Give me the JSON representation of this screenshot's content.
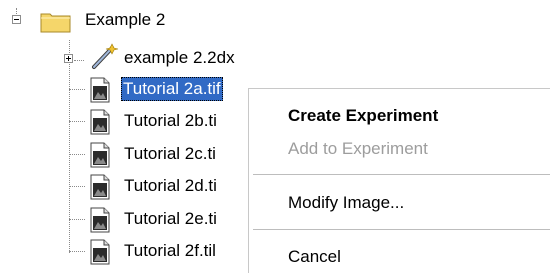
{
  "tree": {
    "folder": {
      "label": "Example 2",
      "icon": "folder-icon",
      "expander": "collapse"
    },
    "children": [
      {
        "label": "example 2.2dx",
        "icon": "wand-icon",
        "expander": "expand"
      },
      {
        "label": "Tutorial 2a.tif",
        "icon": "image-file-icon",
        "selected": true
      },
      {
        "label": "Tutorial 2b.ti",
        "icon": "image-file-icon"
      },
      {
        "label": "Tutorial 2c.ti",
        "icon": "image-file-icon"
      },
      {
        "label": "Tutorial 2d.ti",
        "icon": "image-file-icon"
      },
      {
        "label": "Tutorial 2e.ti",
        "icon": "image-file-icon"
      },
      {
        "label": "Tutorial 2f.til",
        "icon": "image-file-icon"
      }
    ]
  },
  "context_menu": {
    "items": [
      {
        "label": "Create Experiment",
        "style": "default"
      },
      {
        "label": "Add to Experiment",
        "style": "disabled"
      },
      {
        "label": "Modify Image...",
        "style": "normal"
      },
      {
        "label": "Cancel",
        "style": "normal"
      }
    ]
  },
  "colors": {
    "selection": "#316ac5",
    "folder_yellow": "#f5d66a",
    "disabled_text": "#9d9d9d"
  }
}
